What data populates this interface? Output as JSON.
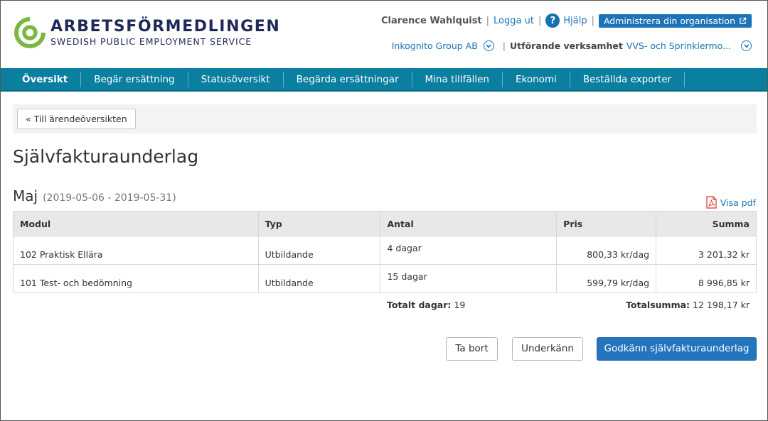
{
  "header": {
    "logo_title": "ARBETSFÖRMEDLINGEN",
    "logo_subtitle": "SWEDISH PUBLIC EMPLOYMENT SERVICE",
    "user_name": "Clarence Wahlquist",
    "logout": "Logga ut",
    "help": "Hjälp",
    "admin_button": "Administrera din organisation",
    "organisation": "Inkognito Group AB",
    "operation_label": "Utförande verksamhet",
    "operation_value": "VVS- och Sprinklermo...",
    "separator": "|",
    "help_glyph": "?"
  },
  "nav": {
    "items": [
      {
        "label": "Översikt"
      },
      {
        "label": "Begär ersättning"
      },
      {
        "label": "Statusöversikt"
      },
      {
        "label": "Begärda ersättningar"
      },
      {
        "label": "Mina tillfällen"
      },
      {
        "label": "Ekonomi"
      },
      {
        "label": "Beställda exporter"
      }
    ]
  },
  "back_button": "« Till ärendeöversikten",
  "page_title": "Självfakturaunderlag",
  "section": {
    "month": "Maj",
    "period": "(2019-05-06 - 2019-05-31)",
    "pdf_link": "Visa pdf"
  },
  "table": {
    "headers": {
      "modul": "Modul",
      "typ": "Typ",
      "antal": "Antal",
      "pris": "Pris",
      "summa": "Summa"
    },
    "rows": [
      {
        "modul": "102 Praktisk Ellära",
        "typ": "Utbildande",
        "antal": "4 dagar",
        "pris": "800,33 kr/dag",
        "summa": "3 201,32 kr"
      },
      {
        "modul": "101 Test- och bedömning",
        "typ": "Utbildande",
        "antal": "15 dagar",
        "pris": "599,79 kr/dag",
        "summa": "8 996,85 kr"
      }
    ]
  },
  "totals": {
    "days_label": "Totalt dagar:",
    "days_value": "19",
    "sum_label": "Totalsumma:",
    "sum_value": "12 198,17 kr"
  },
  "actions": {
    "remove": "Ta bort",
    "reject": "Underkänn",
    "approve": "Godkänn självfakturaunderlag"
  },
  "colors": {
    "nav_bg": "#0b7fa0",
    "primary_button": "#2574be",
    "logo_green": "#7ab842",
    "logo_navy": "#1f2a5a"
  }
}
